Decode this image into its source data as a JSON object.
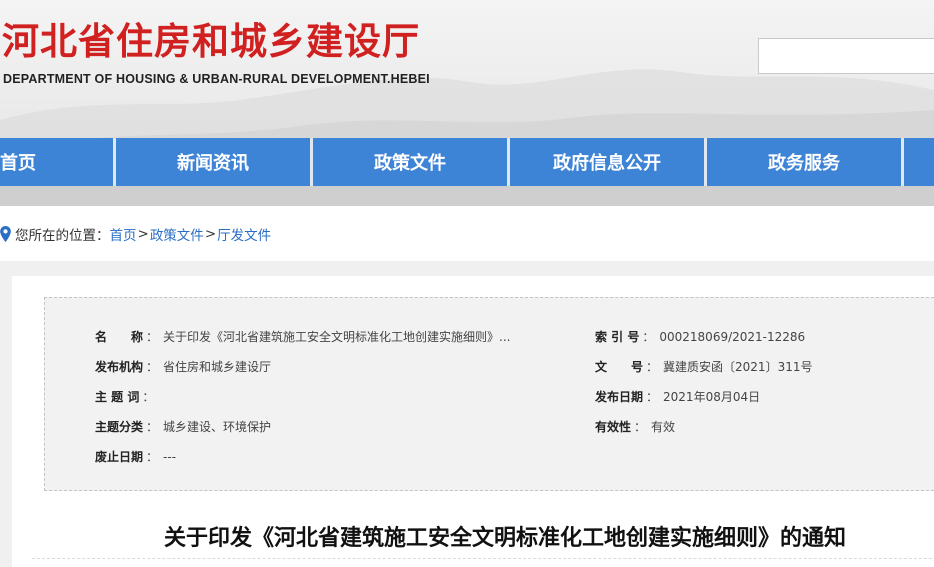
{
  "header": {
    "title": "河北省住房和城乡建设厅",
    "subtitle": "DEPARTMENT OF HOUSING & URBAN-RURAL DEVELOPMENT.HEBEI",
    "search_value": ""
  },
  "nav": {
    "items": [
      "首页",
      "新闻资讯",
      "政策文件",
      "政府信息公开",
      "政务服务"
    ]
  },
  "breadcrumb": {
    "prefix": "您所在的位置：",
    "items": [
      "首页",
      "政策文件",
      "厅发文件"
    ],
    "separator": ">"
  },
  "meta": {
    "name_label": "名　　称",
    "name_value": "关于印发《河北省建筑施工安全文明标准化工地创建实施细则》...",
    "org_label": "发布机构",
    "org_value": "省住房和城乡建设厅",
    "keywords_label": "主 题 词",
    "keywords_value": "",
    "category_label": "主题分类",
    "category_value": "城乡建设、环境保护",
    "expire_label": "废止日期",
    "expire_value": "---",
    "index_label": "索 引 号",
    "index_value": "000218069/2021-12286",
    "docno_label": "文　　号",
    "docno_value": "冀建质安函〔2021〕311号",
    "date_label": "发布日期",
    "date_value": "2021年08月04日",
    "validity_label": "有效性",
    "validity_value": "有效",
    "separator": "："
  },
  "document": {
    "title": "关于印发《河北省建筑施工安全文明标准化工地创建实施细则》的通知"
  },
  "colors": {
    "brand_red": "#d12020",
    "nav_blue": "#3e84d6",
    "link_blue": "#2a6ec6"
  },
  "icons": {
    "location": "map-pin-icon"
  }
}
